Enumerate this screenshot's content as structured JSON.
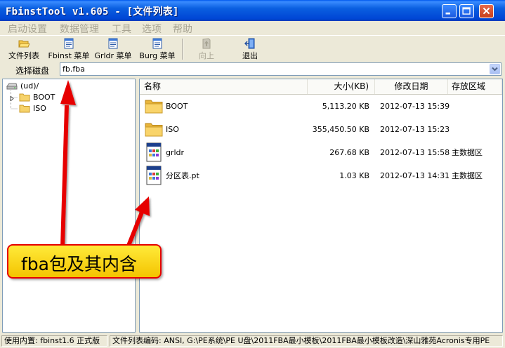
{
  "window": {
    "title": "FbinstTool v1.605 - [文件列表]"
  },
  "menu": {
    "items": [
      "启动设置",
      "数据管理",
      "工具",
      "选项",
      "帮助"
    ]
  },
  "toolbar": {
    "buttons": [
      {
        "label": "文件列表",
        "icon": "folder-open-icon",
        "enabled": true
      },
      {
        "label": "Fbinst 菜单",
        "icon": "document-icon",
        "enabled": true
      },
      {
        "label": "Grldr 菜单",
        "icon": "document-icon",
        "enabled": true
      },
      {
        "label": "Burg 菜单",
        "icon": "document-icon",
        "enabled": true
      },
      {
        "label": "向上",
        "icon": "up-icon",
        "enabled": false
      },
      {
        "label": "退出",
        "icon": "exit-icon",
        "enabled": true
      }
    ]
  },
  "disk": {
    "label": "选择磁盘",
    "value": "fb.fba"
  },
  "tree": {
    "root": "(ud)/",
    "children": [
      "BOOT",
      "ISO"
    ]
  },
  "list": {
    "columns": [
      "名称",
      "大小(KB)",
      "修改日期",
      "存放区域"
    ],
    "rows": [
      {
        "name": "BOOT",
        "size": "5,113.20 KB",
        "date": "2012-07-13 15:39",
        "area": "",
        "icon": "folder-icon"
      },
      {
        "name": "ISO",
        "size": "355,450.50 KB",
        "date": "2012-07-13 15:23",
        "area": "",
        "icon": "folder-icon"
      },
      {
        "name": "grldr",
        "size": "267.68 KB",
        "date": "2012-07-13 15:58",
        "area": "主数据区",
        "icon": "file-icon"
      },
      {
        "name": "分区表.pt",
        "size": "1.03 KB",
        "date": "2012-07-13 14:31",
        "area": "主数据区",
        "icon": "file-icon"
      }
    ]
  },
  "status": {
    "left": "使用内置: fbinst1.6 正式版",
    "right": "文件列表编码: ANSI, G:\\PE系统\\PE U盘\\2011FBA最小模板\\2011FBA最小模板改造\\深山雅苑Acronis专用PE"
  },
  "callout": {
    "text": "fba包及其内含"
  },
  "colors": {
    "titlebar": "#0a5fe0",
    "callout_fill": "#ffd800",
    "callout_border": "#e60000",
    "arrow": "#e60000"
  }
}
